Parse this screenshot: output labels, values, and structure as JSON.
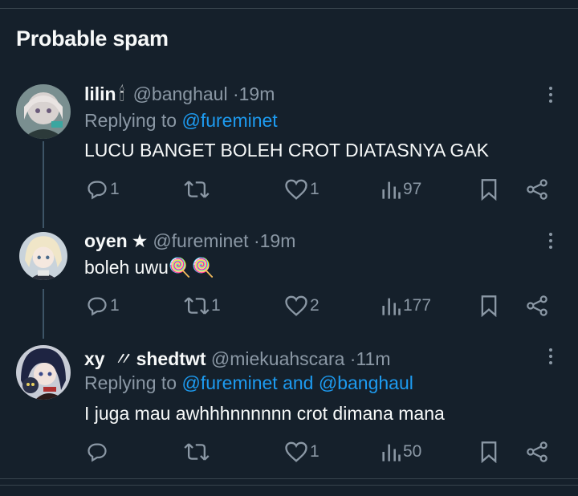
{
  "section": {
    "title": "Probable spam"
  },
  "colors": {
    "background": "#15202b",
    "text": "#f7f9f9",
    "muted": "#8b98a5",
    "link": "#1d9bf0"
  },
  "tweets": [
    {
      "name": "lilin",
      "emoji": "🕯",
      "handle": "@banghaul",
      "sep": "·",
      "time": "19m",
      "replying_prefix": "Replying to",
      "replying_to": "@fureminet",
      "text": "LUCU BANGET BOLEH CROT DIATASNYA GAK",
      "replies": "1",
      "retweets": "",
      "likes": "1",
      "views": "97",
      "avatar_icon": "anime-avatar-silver-hair"
    },
    {
      "name": "oyen",
      "emoji": "★",
      "handle": "@fureminet",
      "sep": "·",
      "time": "19m",
      "text": "boleh uwu",
      "text_emoji": "🍭🍭",
      "replies": "1",
      "retweets": "1",
      "likes": "2",
      "views": "177",
      "avatar_icon": "anime-avatar-blonde"
    },
    {
      "name": "xy",
      "emoji": "〃",
      "name_suffix": "shedtwt",
      "handle": "@miekuahscara",
      "sep": "·",
      "time": "11m",
      "replying_prefix": "Replying to",
      "replying_to": "@fureminet and @banghaul",
      "text": "I juga mau awhhhnnnnnn crot dimana mana",
      "replies": "",
      "retweets": "",
      "likes": "1",
      "views": "50",
      "avatar_icon": "anime-avatar-dark-hair-cat"
    }
  ]
}
